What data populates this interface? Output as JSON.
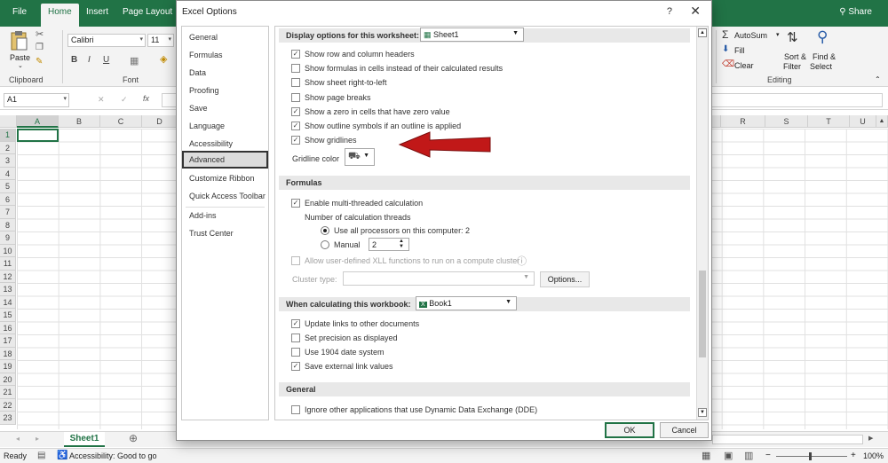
{
  "ribbon": {
    "tabs": [
      "File",
      "Home",
      "Insert",
      "Page Layout"
    ],
    "active_tab": "Home",
    "share": "Share",
    "paste_label": "Paste",
    "clipboard_label": "Clipboard",
    "font_group_label": "Font",
    "font_name": "Calibri",
    "font_size": "11",
    "bold": "B",
    "italic": "I",
    "underline": "U",
    "autosum": "AutoSum",
    "fill": "Fill",
    "clear": "Clear",
    "sort_filter_line1": "Sort &",
    "sort_filter_line2": "Filter",
    "find_select_line1": "Find &",
    "find_select_line2": "Select",
    "editing_label": "Editing",
    "accent": "#217346"
  },
  "formula_bar": {
    "name_box": "A1",
    "cancel": "✕",
    "enter": "✓",
    "fx": "fx"
  },
  "grid": {
    "left_columns": [
      "A",
      "B",
      "C",
      "D"
    ],
    "right_columns": [
      "R",
      "S",
      "T",
      "U"
    ],
    "rows": [
      "1",
      "2",
      "3",
      "4",
      "5",
      "6",
      "7",
      "8",
      "9",
      "10",
      "11",
      "12",
      "13",
      "14",
      "15",
      "16",
      "17",
      "18",
      "19",
      "20",
      "21",
      "22",
      "23"
    ]
  },
  "sheet_tab": "Sheet1",
  "status": {
    "ready": "Ready",
    "accessibility": "Accessibility: Good to go",
    "zoom": "100%"
  },
  "dialog": {
    "title": "Excel Options",
    "help": "?",
    "nav": [
      "General",
      "Formulas",
      "Data",
      "Proofing",
      "Save",
      "Language",
      "Accessibility",
      "Advanced",
      "Customize Ribbon",
      "Quick Access Toolbar",
      "Add-ins",
      "Trust Center"
    ],
    "selected_nav": "Advanced",
    "worksheet_section": {
      "header": "Display options for this worksheet:",
      "sheet": "Sheet1",
      "options": [
        {
          "label": "Show row and column headers",
          "checked": true
        },
        {
          "label": "Show formulas in cells instead of their calculated results",
          "checked": false
        },
        {
          "label": "Show sheet right-to-left",
          "checked": false
        },
        {
          "label": "Show page breaks",
          "checked": false
        },
        {
          "label": "Show a zero in cells that have zero value",
          "checked": true
        },
        {
          "label": "Show outline symbols if an outline is applied",
          "checked": true
        },
        {
          "label": "Show gridlines",
          "checked": true
        }
      ],
      "gridline_color_label": "Gridline color"
    },
    "formulas_section": {
      "header": "Formulas",
      "multithread": "Enable multi-threaded calculation",
      "threads_label": "Number of calculation threads",
      "use_all": "Use all processors on this computer:",
      "processor_count": "2",
      "manual": "Manual",
      "manual_value": "2",
      "xll": "Allow user-defined XLL functions to run on a compute cluster",
      "cluster_type": "Cluster type:",
      "options_btn": "Options..."
    },
    "workbook_section": {
      "header": "When calculating this workbook:",
      "book": "Book1",
      "options": [
        {
          "label": "Update links to other documents",
          "checked": true
        },
        {
          "label": "Set precision as displayed",
          "checked": false
        },
        {
          "label": "Use 1904 date system",
          "checked": false
        },
        {
          "label": "Save external link values",
          "checked": true
        }
      ]
    },
    "general_section": {
      "header": "General",
      "dde": "Ignore other applications that use Dynamic Data Exchange (DDE)"
    },
    "ok": "OK",
    "cancel": "Cancel"
  }
}
